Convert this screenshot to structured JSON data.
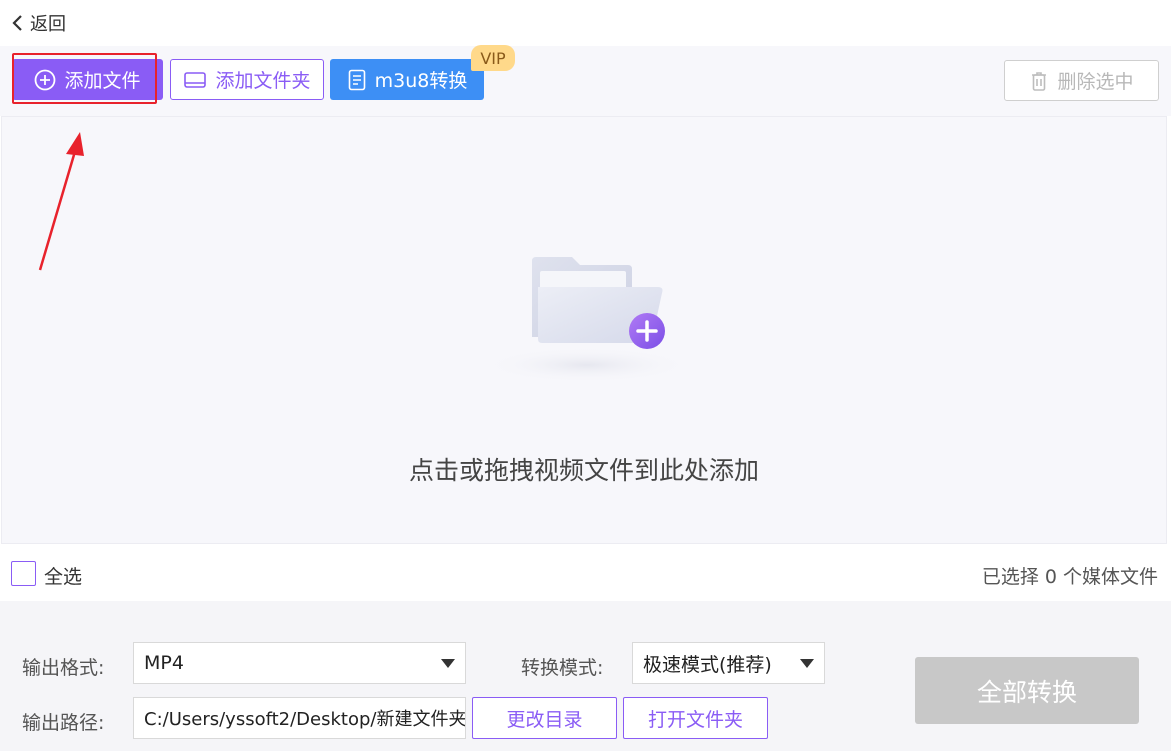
{
  "nav": {
    "back_label": "返回"
  },
  "toolbar": {
    "add_file_label": "添加文件",
    "add_folder_label": "添加文件夹",
    "m3u8_label": "m3u8转换",
    "vip_badge": "VIP",
    "delete_selected_label": "删除选中",
    "colors": {
      "primary": "#8a5cf5",
      "blue": "#3d8ff5",
      "vip": "#ffd98a",
      "highlight": "#e8222c"
    }
  },
  "drop_area": {
    "hint": "点击或拖拽视频文件到此处添加",
    "icon": "folder-plus-icon"
  },
  "selection": {
    "select_all_label": "全选",
    "selected_count_text": "已选择 0 个媒体文件",
    "checked": false
  },
  "settings": {
    "output_format_label": "输出格式:",
    "output_format_value": "MP4",
    "convert_mode_label": "转换模式:",
    "convert_mode_value": "极速模式(推荐)",
    "output_path_label": "输出路径:",
    "output_path_value": "C:/Users/yssoft2/Desktop/新建文件夹",
    "change_dir_label": "更改目录",
    "open_folder_label": "打开文件夹",
    "convert_all_label": "全部转换"
  }
}
